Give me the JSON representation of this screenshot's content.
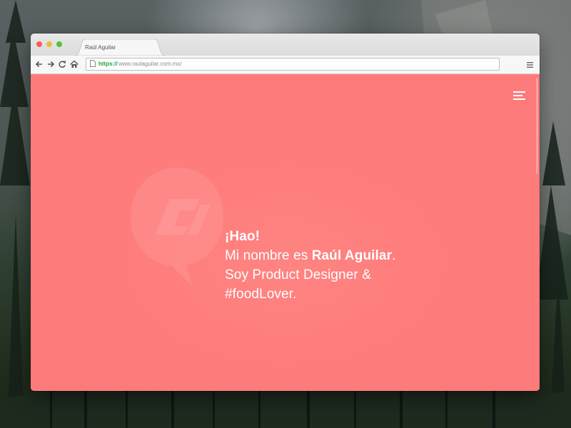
{
  "desktop": {
    "wallpaper": "forest-mountain-wallpaper"
  },
  "browser": {
    "tab": {
      "title": "Raúl Aguilar"
    },
    "window_controls": [
      "close",
      "minimize",
      "maximize"
    ],
    "toolbar": {
      "back_icon": "arrow-left-icon",
      "forward_icon": "arrow-right-icon",
      "reload_icon": "reload-icon",
      "home_icon": "home-icon",
      "menu_icon": "menu-icon"
    },
    "address_bar": {
      "scheme": "https://",
      "url": "www.raulaguilar.com.mx/"
    }
  },
  "page": {
    "background_color": "#fe7b7b",
    "hero": {
      "greeting": "¡Hao!",
      "name_prefix": "Mi nombre es ",
      "name": "Raúl Aguilar",
      "name_suffix": ".",
      "line3": "Soy Product Designer &",
      "line4": "#foodLover."
    },
    "nav_icon": "hamburger-menu-icon",
    "scroll_icon": "arrow-down-icon",
    "logo_icon": "ra-speech-bubble-logo"
  }
}
